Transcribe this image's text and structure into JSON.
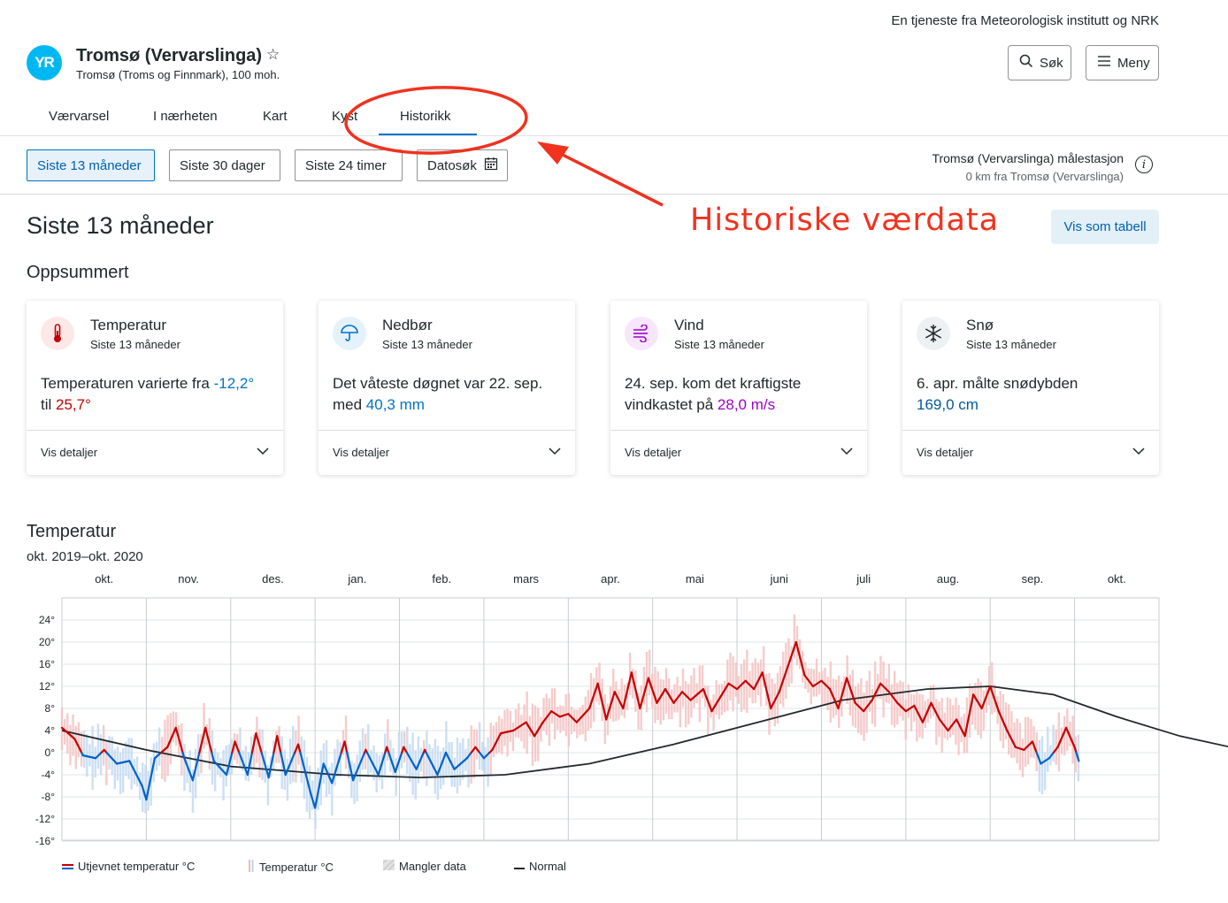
{
  "header": {
    "tagline": "En tjeneste fra Meteorologisk institutt og NRK",
    "logo_text": "YR",
    "location_title": "Tromsø (Vervarslinga)",
    "location_subtitle": "Tromsø (Troms og Finnmark), 100 moh.",
    "search_label": "Søk",
    "menu_label": "Meny"
  },
  "tabs": [
    {
      "label": "Værvarsel",
      "active": false
    },
    {
      "label": "I nærheten",
      "active": false
    },
    {
      "label": "Kart",
      "active": false
    },
    {
      "label": "Kyst",
      "active": false
    },
    {
      "label": "Historikk",
      "active": true
    }
  ],
  "filters": [
    {
      "label": "Siste 13 måneder",
      "active": true
    },
    {
      "label": "Siste 30 dager",
      "active": false
    },
    {
      "label": "Siste 24 timer",
      "active": false
    },
    {
      "label": "Datosøk",
      "active": false
    }
  ],
  "station": {
    "name": "Tromsø (Vervarslinga) målestasjon",
    "distance": "0 km fra Tromsø (Vervarslinga)"
  },
  "page_title": "Siste 13 måneder",
  "table_button": "Vis som tabell",
  "summary_heading": "Oppsummert",
  "annotation": {
    "text": "Historiske værdata",
    "color": "#f0321e"
  },
  "cards": [
    {
      "title": "Temperatur",
      "subtitle": "Siste 13 måneder",
      "icon": "thermometer-icon",
      "text_before": "Temperaturen varierte fra ",
      "value1": "-12,2°",
      "text_middle": " til ",
      "value2": "25,7°",
      "text_after": "",
      "details": "Vis detaljer"
    },
    {
      "title": "Nedbør",
      "subtitle": "Siste 13 måneder",
      "icon": "umbrella-icon",
      "text_before": "Det våteste døgnet var 22. sep. med ",
      "value1": "40,3 mm",
      "details": "Vis detaljer"
    },
    {
      "title": "Vind",
      "subtitle": "Siste 13 måneder",
      "icon": "wind-icon",
      "text_before": "24. sep. kom det kraftigste vindkastet på ",
      "value1": "28,0 m/s",
      "details": "Vis detaljer"
    },
    {
      "title": "Snø",
      "subtitle": "Siste 13 måneder",
      "icon": "snowflake-icon",
      "text_before": "6. apr. målte snødybden ",
      "value1": "169,0 cm",
      "details": "Vis detaljer"
    }
  ],
  "chart_section": {
    "title": "Temperatur",
    "subtitle": "okt. 2019–okt. 2020"
  },
  "legend": {
    "smoothed": "Utjevnet temperatur °C",
    "temperature": "Temperatur °C",
    "missing": "Mangler data",
    "normal": "Normal"
  },
  "colors": {
    "accent_blue": "#0072c9",
    "warm": "#c60000",
    "cold": "#0061c9",
    "normal_line": "#21292b"
  },
  "chart_data": {
    "type": "line",
    "title": "",
    "xlabel": "",
    "ylabel": "",
    "x_categories": [
      "okt.",
      "nov.",
      "des.",
      "jan.",
      "feb.",
      "mars",
      "apr.",
      "mai",
      "juni",
      "juli",
      "aug.",
      "sep.",
      "okt."
    ],
    "y_ticks": [
      24,
      20,
      16,
      12,
      8,
      4,
      0,
      -4,
      -8,
      -12,
      -16
    ],
    "ylim": [
      -16,
      27
    ],
    "grid": true,
    "legend_position": "bottom",
    "series": [
      {
        "name": "Utjevnet temperatur °C",
        "note": "smoothed daily temperature, red above 0°, blue below 0°",
        "points": [
          [
            0.0,
            4.5
          ],
          [
            0.3,
            2.5
          ],
          [
            0.5,
            -0.5
          ],
          [
            0.8,
            -1.0
          ],
          [
            1.0,
            0.5
          ],
          [
            1.3,
            -2.0
          ],
          [
            1.6,
            -1.5
          ],
          [
            1.9,
            -6.0
          ],
          [
            2.0,
            -8.5
          ],
          [
            2.2,
            -1.0
          ],
          [
            2.5,
            1.0
          ],
          [
            2.7,
            4.5
          ],
          [
            2.9,
            -1.0
          ],
          [
            3.1,
            -5.0
          ],
          [
            3.4,
            4.5
          ],
          [
            3.6,
            -1.5
          ],
          [
            3.9,
            -4.0
          ],
          [
            4.1,
            2.0
          ],
          [
            4.4,
            -4.0
          ],
          [
            4.6,
            3.5
          ],
          [
            4.9,
            -4.5
          ],
          [
            5.1,
            3.0
          ],
          [
            5.3,
            -4.0
          ],
          [
            5.6,
            1.5
          ],
          [
            5.9,
            -7.5
          ],
          [
            6.0,
            -10.0
          ],
          [
            6.2,
            -2.0
          ],
          [
            6.4,
            -5.5
          ],
          [
            6.7,
            2.0
          ],
          [
            6.9,
            -5.0
          ],
          [
            7.2,
            0.5
          ],
          [
            7.5,
            -4.0
          ],
          [
            7.7,
            1.0
          ],
          [
            7.9,
            -3.5
          ],
          [
            8.1,
            1.0
          ],
          [
            8.4,
            -3.0
          ],
          [
            8.6,
            0.5
          ],
          [
            8.9,
            -4.0
          ],
          [
            9.1,
            0.0
          ],
          [
            9.3,
            -3.0
          ],
          [
            9.6,
            -1.0
          ],
          [
            9.8,
            1.0
          ],
          [
            10.0,
            -1.0
          ],
          [
            10.2,
            0.5
          ],
          [
            10.4,
            3.5
          ],
          [
            10.7,
            4.0
          ],
          [
            11.0,
            5.5
          ],
          [
            11.2,
            3.0
          ],
          [
            11.4,
            5.5
          ],
          [
            11.6,
            7.5
          ],
          [
            11.8,
            6.5
          ],
          [
            12.0,
            7.0
          ],
          [
            12.2,
            5.5
          ],
          [
            12.5,
            8.0
          ],
          [
            12.7,
            12.5
          ],
          [
            12.9,
            6.0
          ],
          [
            13.1,
            11.0
          ],
          [
            13.3,
            8.0
          ],
          [
            13.5,
            14.5
          ],
          [
            13.7,
            8.0
          ],
          [
            13.9,
            13.5
          ],
          [
            14.1,
            9.0
          ],
          [
            14.3,
            11.5
          ],
          [
            14.5,
            9.0
          ],
          [
            14.7,
            11.0
          ],
          [
            14.9,
            9.5
          ],
          [
            15.2,
            11.5
          ],
          [
            15.4,
            7.5
          ],
          [
            15.6,
            10.0
          ],
          [
            15.8,
            12.5
          ],
          [
            16.0,
            11.5
          ],
          [
            16.2,
            13.0
          ],
          [
            16.4,
            11.5
          ],
          [
            16.6,
            14.5
          ],
          [
            16.8,
            8.0
          ],
          [
            17.0,
            11.0
          ],
          [
            17.2,
            15.5
          ],
          [
            17.4,
            20.0
          ],
          [
            17.6,
            14.0
          ],
          [
            17.8,
            12.0
          ],
          [
            18.0,
            13.0
          ],
          [
            18.2,
            11.5
          ],
          [
            18.4,
            8.0
          ],
          [
            18.6,
            13.5
          ],
          [
            18.8,
            9.0
          ],
          [
            19.0,
            7.5
          ],
          [
            19.2,
            9.5
          ],
          [
            19.4,
            12.5
          ],
          [
            19.6,
            11.0
          ],
          [
            19.8,
            9.0
          ],
          [
            20.0,
            7.5
          ],
          [
            20.2,
            8.5
          ],
          [
            20.4,
            5.5
          ],
          [
            20.6,
            9.0
          ],
          [
            20.8,
            6.0
          ],
          [
            21.0,
            4.0
          ],
          [
            21.2,
            6.0
          ],
          [
            21.4,
            3.0
          ],
          [
            21.6,
            10.5
          ],
          [
            21.8,
            8.0
          ],
          [
            22.0,
            12.0
          ],
          [
            22.2,
            7.5
          ],
          [
            22.4,
            4.0
          ],
          [
            22.6,
            1.0
          ],
          [
            22.8,
            0.5
          ],
          [
            23.0,
            2.0
          ],
          [
            23.2,
            -2.0
          ],
          [
            23.4,
            -1.0
          ],
          [
            23.6,
            1.0
          ],
          [
            23.8,
            4.5
          ],
          [
            24.0,
            1.0
          ],
          [
            24.1,
            -1.5
          ]
        ]
      },
      {
        "name": "Normal",
        "points": [
          [
            0.0,
            4.0
          ],
          [
            2.0,
            0.5
          ],
          [
            4.0,
            -2.5
          ],
          [
            6.5,
            -4.0
          ],
          [
            8.5,
            -4.5
          ],
          [
            10.5,
            -4.0
          ],
          [
            12.5,
            -2.0
          ],
          [
            14.5,
            1.5
          ],
          [
            16.5,
            5.5
          ],
          [
            18.5,
            9.5
          ],
          [
            20.5,
            11.5
          ],
          [
            22.0,
            12.0
          ],
          [
            23.5,
            10.5
          ],
          [
            25.0,
            6.5
          ],
          [
            26.5,
            3.0
          ],
          [
            28.0,
            0.5
          ]
        ]
      }
    ]
  }
}
